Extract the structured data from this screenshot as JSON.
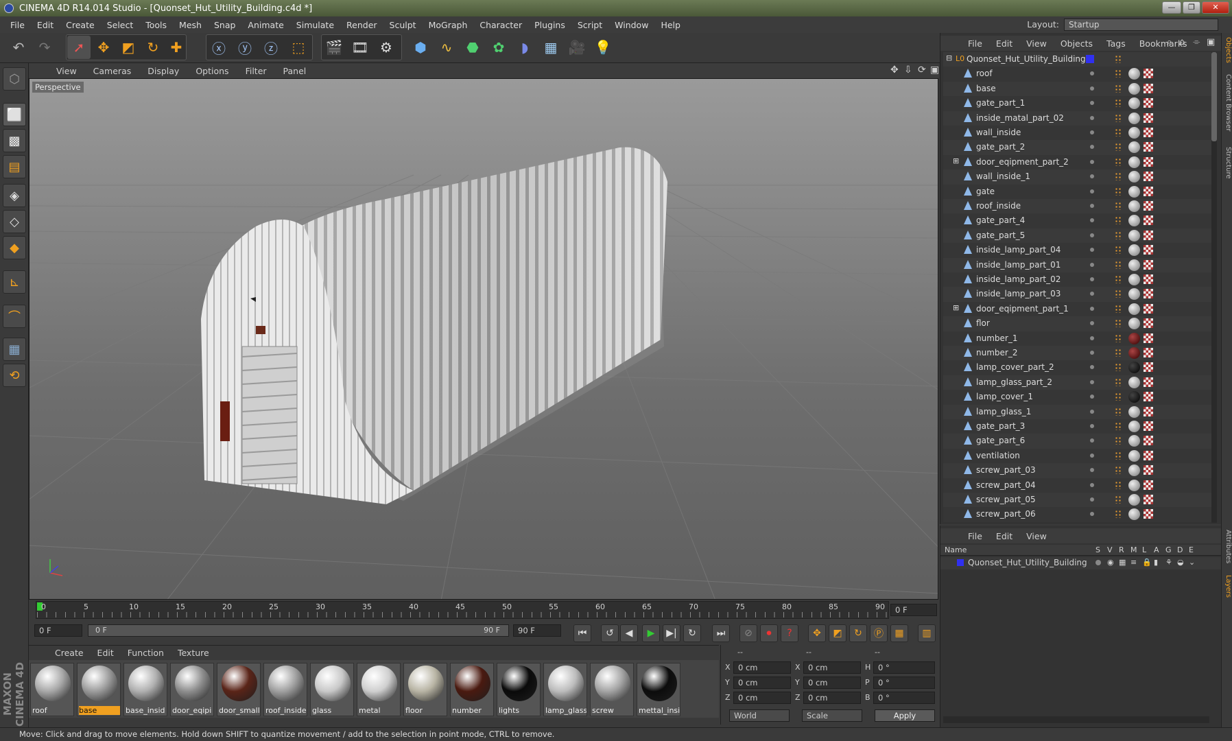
{
  "titlebar": {
    "title": "CINEMA 4D R14.014 Studio - [Quonset_Hut_Utility_Building.c4d *]",
    "min": "—",
    "max": "❐",
    "close": "✕"
  },
  "menu": [
    "File",
    "Edit",
    "Create",
    "Select",
    "Tools",
    "Mesh",
    "Snap",
    "Animate",
    "Simulate",
    "Render",
    "Sculpt",
    "MoGraph",
    "Character",
    "Plugins",
    "Script",
    "Window",
    "Help"
  ],
  "layout": {
    "label": "Layout:",
    "value": "Startup"
  },
  "viewport": {
    "menu": [
      "View",
      "Cameras",
      "Display",
      "Options",
      "Filter",
      "Panel"
    ],
    "camera": "Perspective"
  },
  "timeline": {
    "ticks": [
      "0",
      "5",
      "10",
      "15",
      "20",
      "25",
      "30",
      "35",
      "40",
      "45",
      "50",
      "55",
      "60",
      "65",
      "70",
      "75",
      "80",
      "85",
      "90"
    ],
    "current": "0 F"
  },
  "transport": {
    "start": "0 F",
    "range_start": "0 F",
    "range_end": "90 F",
    "end": "90 F"
  },
  "materials": {
    "menu": [
      "Create",
      "Edit",
      "Function",
      "Texture"
    ],
    "items": [
      {
        "name": "roof",
        "color": "#a8a8a8"
      },
      {
        "name": "base",
        "color": "#9c9c9c",
        "selected": true
      },
      {
        "name": "base_insid",
        "color": "#b0b0b0"
      },
      {
        "name": "door_eqipi",
        "color": "#8e8e8e"
      },
      {
        "name": "door_small",
        "color": "#5a2418"
      },
      {
        "name": "roof_inside",
        "color": "#a0a0a0"
      },
      {
        "name": "glass",
        "color": "#c8c8c8"
      },
      {
        "name": "metal",
        "color": "#cfcfcf"
      },
      {
        "name": "floor",
        "color": "#b8b4a4"
      },
      {
        "name": "number",
        "color": "#4a1a10"
      },
      {
        "name": "lights",
        "color": "#0a0a0a"
      },
      {
        "name": "lamp_glass",
        "color": "#bcbcbc"
      },
      {
        "name": "screw",
        "color": "#a4a4a4"
      },
      {
        "name": "mettal_insi",
        "color": "#0c0c0c"
      }
    ]
  },
  "coords": {
    "header": [
      "--",
      "--",
      "--"
    ],
    "rows": [
      {
        "a": "X",
        "av": "0 cm",
        "b": "X",
        "bv": "0 cm",
        "c": "H",
        "cv": "0 °"
      },
      {
        "a": "Y",
        "av": "0 cm",
        "b": "Y",
        "bv": "0 cm",
        "c": "P",
        "cv": "0 °"
      },
      {
        "a": "Z",
        "av": "0 cm",
        "b": "Z",
        "bv": "0 cm",
        "c": "B",
        "cv": "0 °"
      }
    ],
    "world": "World",
    "scale": "Scale",
    "apply": "Apply"
  },
  "objects": {
    "menu": [
      "File",
      "Edit",
      "View",
      "Objects",
      "Tags",
      "Bookmarks"
    ],
    "root": "Quonset_Hut_Utility_Building",
    "items": [
      "roof",
      "base",
      "gate_part_1",
      "inside_matal_part_02",
      "wall_inside",
      "gate_part_2",
      "door_eqipment_part_2",
      "wall_inside_1",
      "gate",
      "roof_inside",
      "gate_part_4",
      "gate_part_5",
      "inside_lamp_part_04",
      "inside_lamp_part_01",
      "inside_lamp_part_02",
      "inside_lamp_part_03",
      "door_eqipment_part_1",
      "flor",
      "number_1",
      "number_2",
      "lamp_cover_part_2",
      "lamp_glass_part_2",
      "lamp_cover_1",
      "lamp_glass_1",
      "gate_part_3",
      "gate_part_6",
      "ventilation",
      "screw_part_03",
      "screw_part_04",
      "screw_part_05",
      "screw_part_06"
    ]
  },
  "layers": {
    "menu": [
      "File",
      "Edit",
      "View"
    ],
    "columns": [
      "Name",
      "S",
      "V",
      "R",
      "M",
      "L",
      "A",
      "G",
      "D",
      "E"
    ],
    "row": "Quonset_Hut_Utility_Building"
  },
  "right_tabs": [
    "Objects",
    "Content Browser",
    "Structure",
    "Attributes",
    "Layers"
  ],
  "status": "Move: Click and drag to move elements. Hold down SHIFT to quantize movement / add to the selection in point mode, CTRL to remove.",
  "brand": "MAXON CINEMA 4D"
}
